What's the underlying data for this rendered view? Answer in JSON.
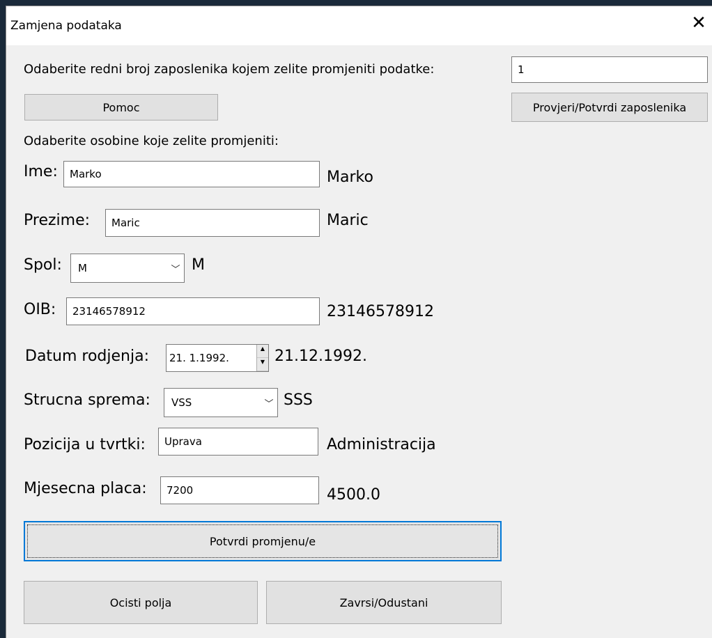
{
  "window": {
    "title": "Zamjena podataka",
    "close_icon": "close-icon"
  },
  "select_prompt": "Odaberite redni broj zaposlenika kojem zelite promjeniti podatke:",
  "employee_number": "1",
  "buttons": {
    "help": "Pomoc",
    "check": "Provjeri/Potvrdi zaposlenika",
    "confirm": "Potvrdi promjenu/e",
    "clear": "Ocisti polja",
    "exit": "Zavrsi/Odustani"
  },
  "attributes_prompt": "Odaberite osobine koje zelite promjeniti:",
  "fields": {
    "name": {
      "label": "Ime:",
      "value": "Marko",
      "current": "Marko"
    },
    "surname": {
      "label": "Prezime:",
      "value": "Maric",
      "current": "Maric"
    },
    "sex": {
      "label": "Spol:",
      "value": "M",
      "current": "M"
    },
    "oib": {
      "label": "OIB:",
      "value": "23146578912",
      "current": "23146578912"
    },
    "birthdate": {
      "label": "Datum rodjenja:",
      "value": "21.  1.1992.",
      "current": "21.12.1992."
    },
    "qualification": {
      "label": "Strucna sprema:",
      "value": "VSS",
      "current": "SSS"
    },
    "position": {
      "label": "Pozicija u tvrtki:",
      "value": "Uprava",
      "current": "Administracija"
    },
    "salary": {
      "label": "Mjesecna placa:",
      "value": "7200",
      "current": "4500.0"
    }
  }
}
